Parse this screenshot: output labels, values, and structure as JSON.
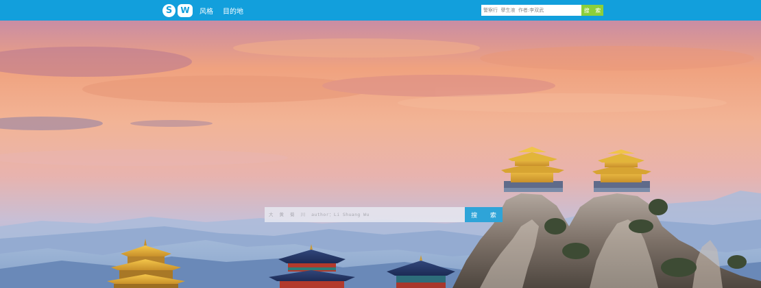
{
  "header": {
    "logo_letters": [
      "S",
      "W"
    ],
    "nav": [
      {
        "label": "风格"
      },
      {
        "label": "目的地"
      }
    ],
    "search": {
      "placeholder": "警察行  孽生液  作者:李双武",
      "button": "搜 索"
    }
  },
  "hero": {
    "scene": "mountain-temples-sunset",
    "search": {
      "placeholder": "大  黄  菊  川  author：Li Shuang Wu",
      "button": "搜 索"
    }
  },
  "colors": {
    "nav_bg": "#129fdc",
    "top_search_button": "#8ccf3a",
    "hero_search_button": "#2ea4d8"
  }
}
